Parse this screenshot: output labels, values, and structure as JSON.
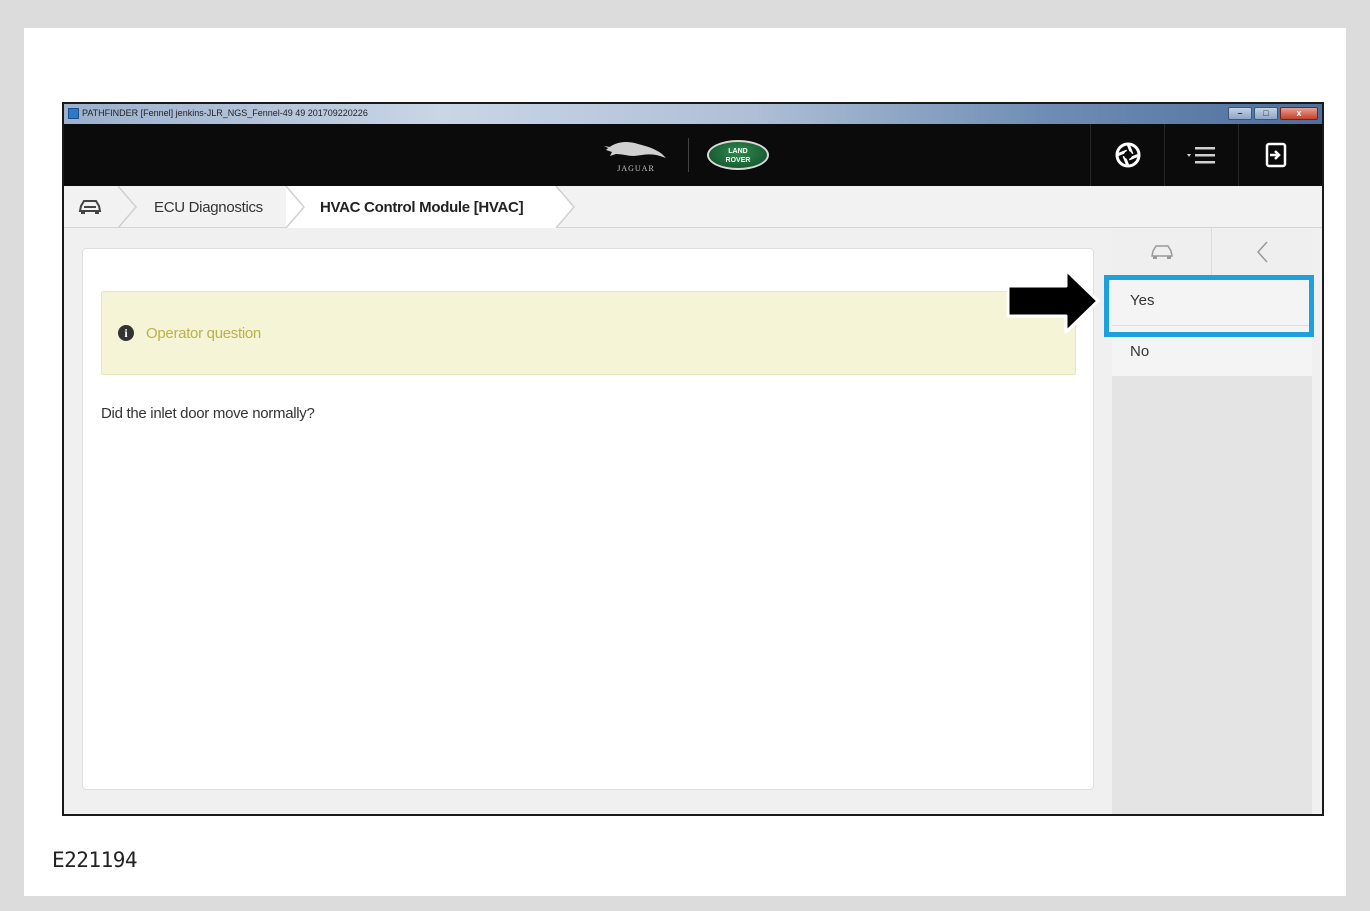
{
  "window": {
    "title": "PATHFINDER [Fennel] jenkins-JLR_NGS_Fennel-49 49 201709220226",
    "min_label": "–",
    "max_label": "□",
    "close_label": "x"
  },
  "header": {
    "jaguar_wordmark": "JAGUAR",
    "landrover_label_line1": "LAND",
    "landrover_label_line2": "ROVER"
  },
  "breadcrumb": {
    "items": [
      {
        "label": "ECU Diagnostics"
      },
      {
        "label": "HVAC Control Module [HVAC]"
      }
    ]
  },
  "alert": {
    "label": "Operator question",
    "color": "#b9b24a"
  },
  "question": {
    "text": "Did the inlet door move normally?"
  },
  "side_panel": {
    "options": [
      {
        "label": "Yes",
        "highlighted": true
      },
      {
        "label": "No",
        "highlighted": false
      }
    ],
    "highlight_color": "#1ea0dc"
  },
  "figure": {
    "code": "E221194"
  }
}
